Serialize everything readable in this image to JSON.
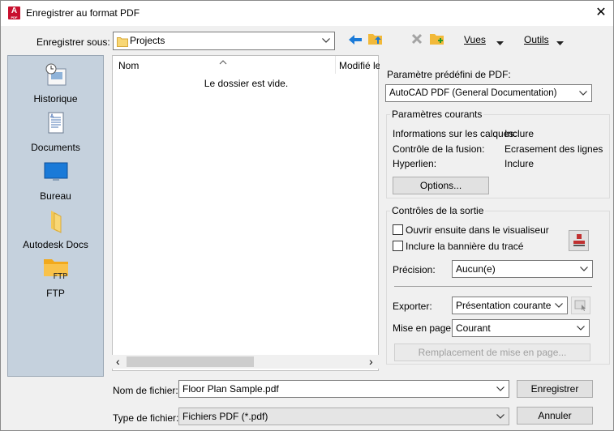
{
  "window": {
    "title": "Enregistrer au format PDF",
    "app_icon_letter": "A",
    "app_icon_sub": "PDF",
    "close_glyph": "✕"
  },
  "toolbar": {
    "save_in_label": "Enregistrer sous:",
    "folder": "Projects",
    "views_label": "Vues",
    "tools_label": "Outils"
  },
  "places": [
    {
      "label": "Historique",
      "icon": "history-icon"
    },
    {
      "label": "Documents",
      "icon": "documents-icon"
    },
    {
      "label": "Bureau",
      "icon": "desktop-icon"
    },
    {
      "label": "Autodesk Docs",
      "icon": "folder-icon"
    },
    {
      "label": "FTP",
      "icon": "ftp-folder-icon",
      "icon_text": "FTP"
    }
  ],
  "filelist": {
    "columns": [
      "Nom",
      "Modifié le"
    ],
    "empty_message": "Le dossier est vide.",
    "scroll_left": "‹",
    "scroll_right": "›"
  },
  "pdf": {
    "preset_label": "Paramètre prédéfini de PDF:",
    "preset_value": "AutoCAD PDF (General Documentation)",
    "current_title": "Paramètres courants",
    "current": [
      {
        "name": "Informations sur les calques:",
        "value": "Inclure"
      },
      {
        "name": "Contrôle de la fusion:",
        "value": "Ecrasement des lignes"
      },
      {
        "name": "Hyperlien:",
        "value": "Inclure"
      }
    ],
    "options_button": "Options...",
    "output_title": "Contrôles de la sortie",
    "open_viewer": "Ouvrir ensuite dans le visualiseur",
    "include_banner": "Inclure la bannière du tracé",
    "precision_label": "Précision:",
    "precision_value": "Aucun(e)",
    "export_label": "Exporter:",
    "export_value": "Présentation courante",
    "page_setup_label": "Mise en page:",
    "page_setup_value": "Courant",
    "override_button": "Remplacement de mise en page..."
  },
  "footer": {
    "filename_label": "Nom de fichier:",
    "filename_value": "Floor Plan Sample.pdf",
    "filetype_label": "Type de fichier:",
    "filetype_value": "Fichiers PDF (*.pdf)",
    "save_button": "Enregistrer",
    "cancel_button": "Annuler"
  }
}
